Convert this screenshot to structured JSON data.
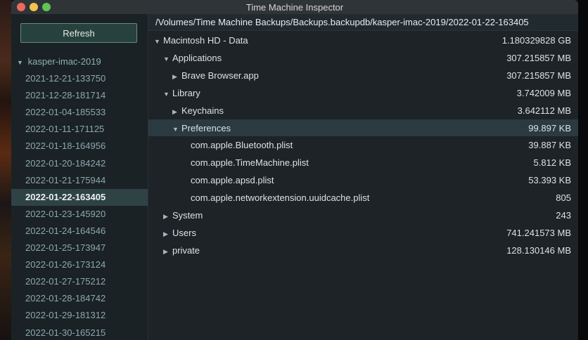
{
  "window": {
    "title": "Time Machine Inspector"
  },
  "sidebar": {
    "refresh_label": "Refresh",
    "host": {
      "label": "kasper-imac-2019",
      "expanded": true
    },
    "snapshots": [
      "2021-12-21-133750",
      "2021-12-28-181714",
      "2022-01-04-185533",
      "2022-01-11-171125",
      "2022-01-18-164956",
      "2022-01-20-184242",
      "2022-01-21-175944",
      "2022-01-22-163405",
      "2022-01-23-145920",
      "2022-01-24-164546",
      "2022-01-25-173947",
      "2022-01-26-173124",
      "2022-01-27-175212",
      "2022-01-28-184742",
      "2022-01-29-181312",
      "2022-01-30-165215"
    ],
    "selected_snapshot": "2022-01-22-163405"
  },
  "main": {
    "path": "/Volumes/Time Machine Backups/Backups.backupdb/kasper-imac-2019/2022-01-22-163405",
    "rows": [
      {
        "name": "Macintosh HD - Data",
        "size": "1.180329828 GB",
        "depth": 0,
        "disclosure": "expanded"
      },
      {
        "name": "Applications",
        "size": "307.215857 MB",
        "depth": 1,
        "disclosure": "expanded"
      },
      {
        "name": "Brave Browser.app",
        "size": "307.215857 MB",
        "depth": 2,
        "disclosure": "collapsed"
      },
      {
        "name": "Library",
        "size": "3.742009 MB",
        "depth": 1,
        "disclosure": "expanded"
      },
      {
        "name": "Keychains",
        "size": "3.642112 MB",
        "depth": 2,
        "disclosure": "collapsed"
      },
      {
        "name": "Preferences",
        "size": "99.897 KB",
        "depth": 2,
        "disclosure": "expanded",
        "selected": true
      },
      {
        "name": "com.apple.Bluetooth.plist",
        "size": "39.887 KB",
        "depth": 3,
        "disclosure": "none"
      },
      {
        "name": "com.apple.TimeMachine.plist",
        "size": "5.812 KB",
        "depth": 3,
        "disclosure": "none"
      },
      {
        "name": "com.apple.apsd.plist",
        "size": "53.393 KB",
        "depth": 3,
        "disclosure": "none"
      },
      {
        "name": "com.apple.networkextension.uuidcache.plist",
        "size": "805",
        "depth": 3,
        "disclosure": "none"
      },
      {
        "name": "System",
        "size": "243",
        "depth": 1,
        "disclosure": "collapsed"
      },
      {
        "name": "Users",
        "size": "741.241573 MB",
        "depth": 1,
        "disclosure": "collapsed"
      },
      {
        "name": "private",
        "size": "128.130146 MB",
        "depth": 1,
        "disclosure": "collapsed"
      }
    ]
  }
}
